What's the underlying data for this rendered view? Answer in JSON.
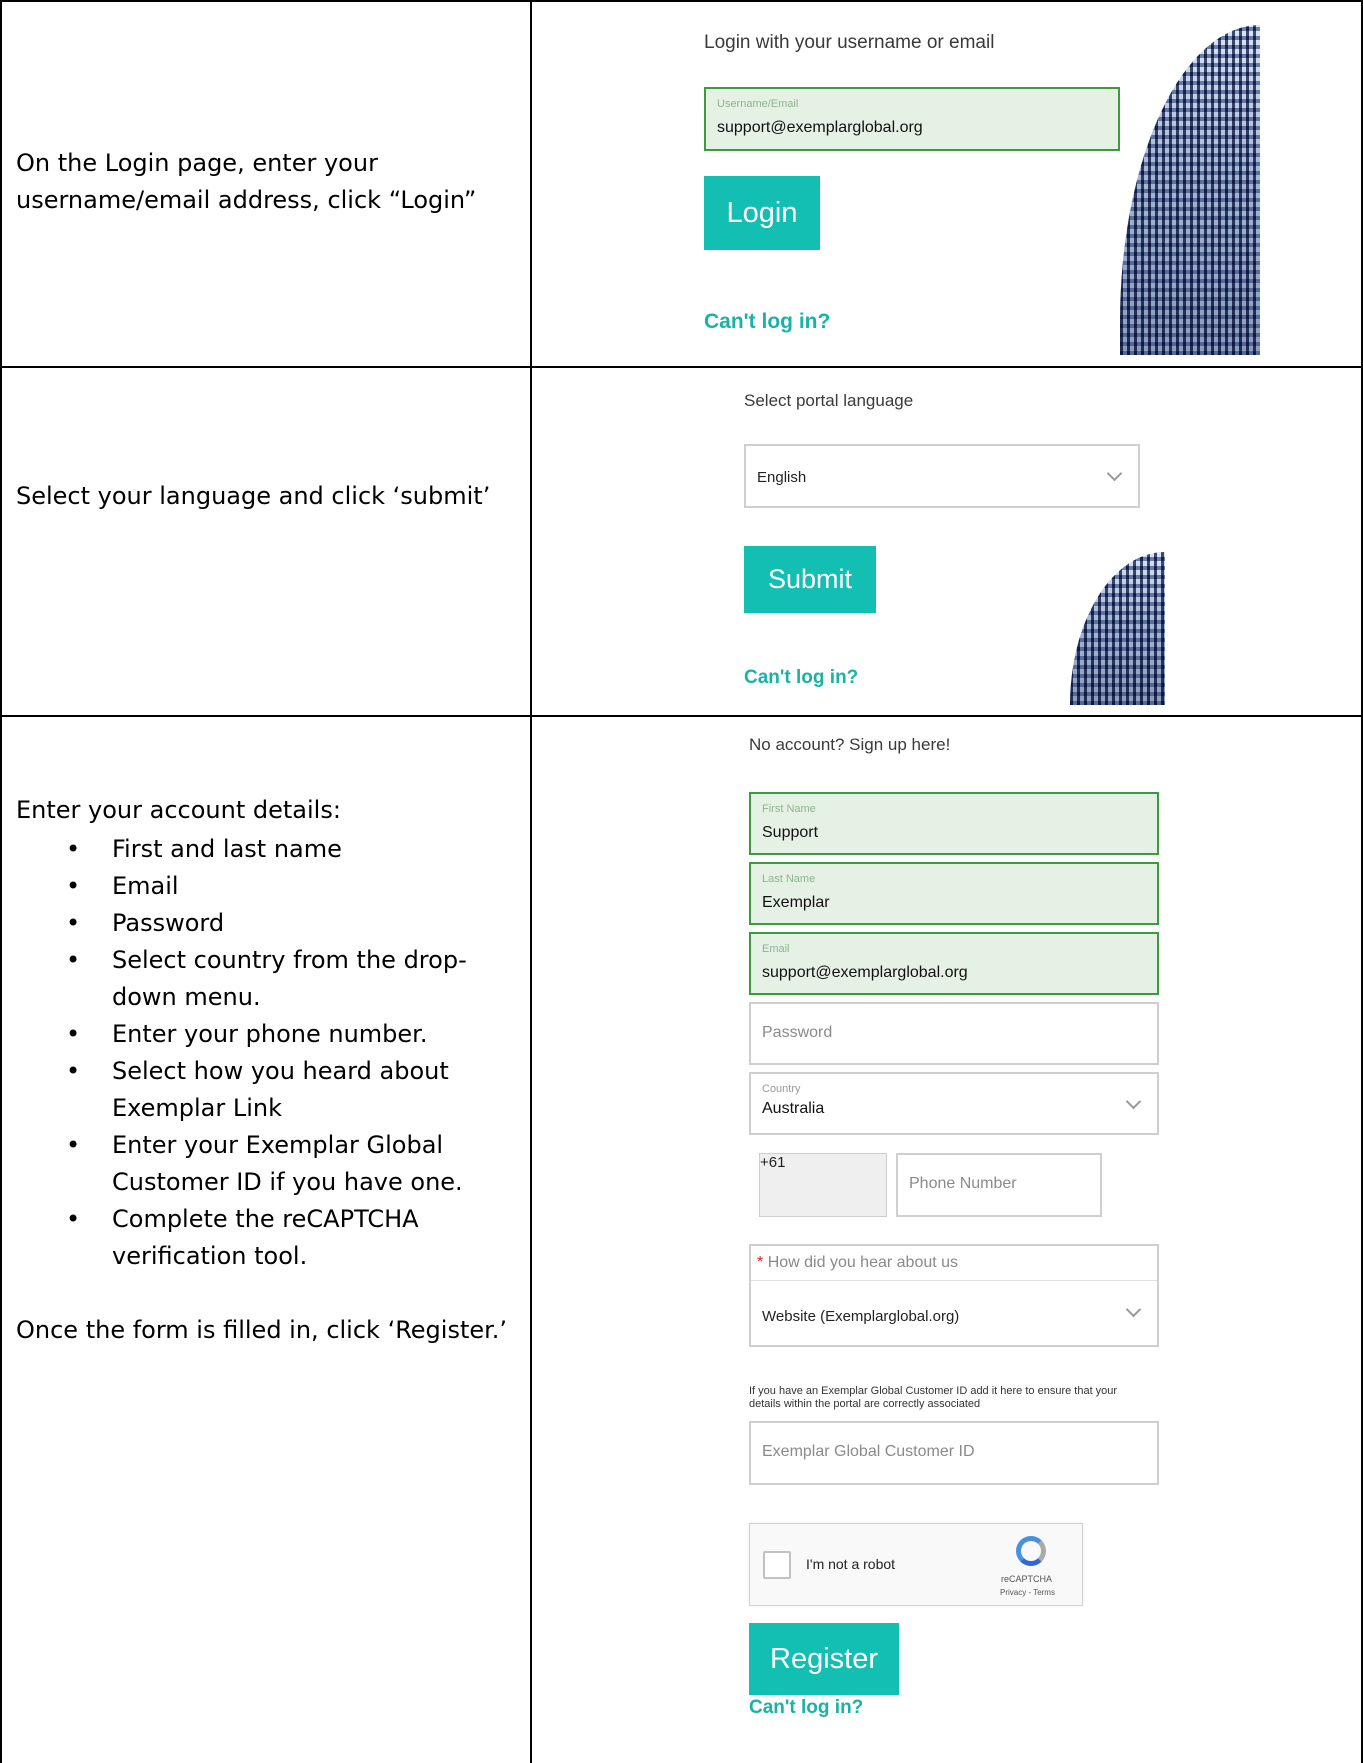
{
  "rows": [
    {
      "instruction": "On the Login page, enter your username/email address, click “Login”"
    },
    {
      "instruction": "Select your language and click ‘submit’"
    },
    {
      "instruction_intro": "Enter your account details:",
      "bullets": [
        "First and last name",
        "Email",
        "Password",
        "Select country from the drop-down menu.",
        "Enter your phone number.",
        "Select how you heard about Exemplar Link",
        "Enter your Exemplar Global Customer ID if you have one.",
        "Complete the reCAPTCHA verification tool."
      ],
      "instruction_outro": "Once the form is filled in, click ‘Register.’"
    }
  ],
  "login": {
    "heading": "Login with your username or email",
    "field_label": "Username/Email",
    "field_value": "support@exemplarglobal.org",
    "button": "Login",
    "cant_login": "Can't log in?"
  },
  "language": {
    "heading": "Select portal language",
    "selected": "English",
    "button": "Submit",
    "cant_login": "Can't log in?"
  },
  "signup": {
    "heading": "No account? Sign up here!",
    "first_name_label": "First Name",
    "first_name_value": "Support",
    "last_name_label": "Last Name",
    "last_name_value": "Exemplar",
    "email_label": "Email",
    "email_value": "support@exemplarglobal.org",
    "password_placeholder": "Password",
    "country_label": "Country",
    "country_value": "Australia",
    "phone_code": "+61",
    "phone_placeholder": "Phone Number",
    "heard_required_mark": "*",
    "heard_label": "How did you hear about us",
    "heard_value": "Website (Exemplarglobal.org)",
    "customer_id_note": "If you have an Exemplar Global Customer ID add it here to ensure that your details within the portal are correctly associated",
    "customer_id_placeholder": "Exemplar Global Customer ID",
    "captcha_label": "I'm not a robot",
    "captcha_brand": "reCAPTCHA",
    "captcha_terms": "Privacy - Terms",
    "button": "Register",
    "cant_login": "Can't log in?"
  },
  "colors": {
    "accent": "#13bfb3",
    "link": "#1ab2a8",
    "filled_border": "#3e9a3e",
    "filled_bg": "#e6f1e5"
  }
}
